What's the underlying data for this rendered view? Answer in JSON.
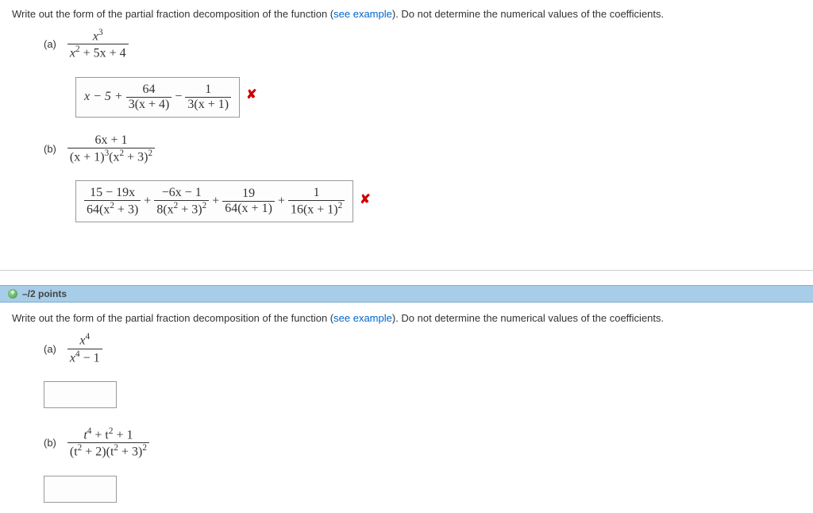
{
  "q1": {
    "prompt_before": "Write out the form of the partial fraction decomposition of the function (",
    "link": "see example",
    "prompt_after": "). Do not determine the numerical values of the coefficients.",
    "a": {
      "label": "(a)",
      "num": "x",
      "num_exp": "3",
      "den_pre": "x",
      "den_exp": "2",
      "den_post": " + 5x + 4",
      "ans_lead": "x − 5 +",
      "ans_f1_num": "64",
      "ans_f1_den": "3(x + 4)",
      "ans_minus": "−",
      "ans_f2_num": "1",
      "ans_f2_den": "3(x + 1)"
    },
    "b": {
      "label": "(b)",
      "num": "6x + 1",
      "den_pre": "(x + 1)",
      "den_exp1": "3",
      "den_mid": "(x",
      "den_exp2": "2",
      "den_post": " + 3)",
      "den_exp3": "2",
      "t1_num": "15 − 19x",
      "t1_den_pre": "64(x",
      "t1_den_exp": "2",
      "t1_den_post": " + 3)",
      "plus1": "+",
      "t2_num": "−6x − 1",
      "t2_den_pre": "8(x",
      "t2_den_exp": "2",
      "t2_den_post": " + 3)",
      "t2_den_oexp": "2",
      "plus2": "+",
      "t3_num": "19",
      "t3_den": "64(x + 1)",
      "plus3": "+",
      "t4_num": "1",
      "t4_den": "16(x + 1)",
      "t4_den_exp": "2"
    }
  },
  "points": "–/2 points",
  "q2": {
    "prompt_before": "Write out the form of the partial fraction decomposition of the function (",
    "link": "see example",
    "prompt_after": "). Do not determine the numerical values of the coefficients.",
    "a": {
      "label": "(a)",
      "num": "x",
      "num_exp": "4",
      "den_pre": "x",
      "den_exp": "4",
      "den_post": " − 1"
    },
    "b": {
      "label": "(b)",
      "num_pre": "t",
      "num_e1": "4",
      "num_mid": " + t",
      "num_e2": "2",
      "num_post": " + 1",
      "den_pre": "(t",
      "den_e1": "2",
      "den_mid": " + 2)(t",
      "den_e2": "2",
      "den_post": " + 3)",
      "den_oexp": "2"
    }
  }
}
